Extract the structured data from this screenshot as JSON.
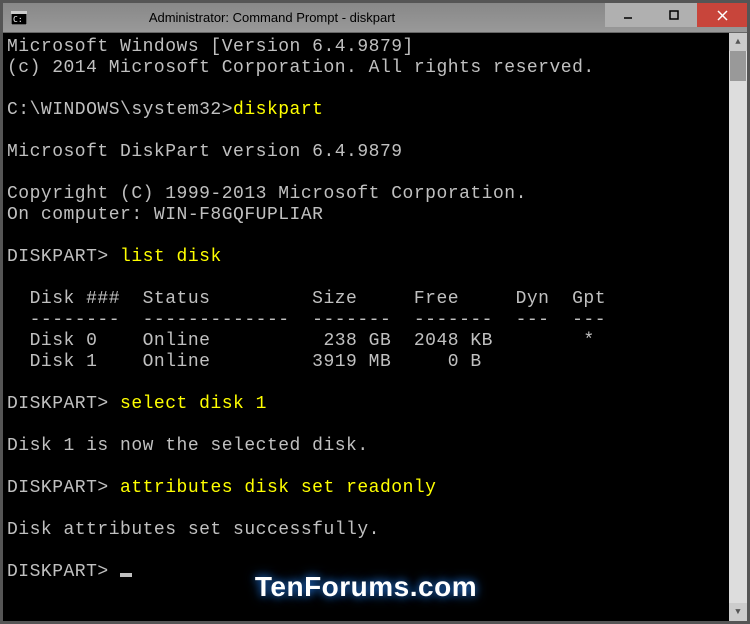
{
  "titlebar": {
    "title": "Administrator: Command Prompt - diskpart"
  },
  "terminal": {
    "line1": "Microsoft Windows [Version 6.4.9879]",
    "line2": "(c) 2014 Microsoft Corporation. All rights reserved.",
    "prompt1_path": "C:\\WINDOWS\\system32>",
    "prompt1_cmd": "diskpart",
    "diskpart_version": "Microsoft DiskPart version 6.4.9879",
    "copyright": "Copyright (C) 1999-2013 Microsoft Corporation.",
    "computer": "On computer: WIN-F8GQFUPLIAR",
    "dp_prompt": "DISKPART> ",
    "cmd_listdisk": "list disk",
    "table_header": "  Disk ###  Status         Size     Free     Dyn  Gpt",
    "table_divider": "  --------  -------------  -------  -------  ---  ---",
    "table_row0": "  Disk 0    Online          238 GB  2048 KB        *",
    "table_row1": "  Disk 1    Online         3919 MB     0 B",
    "cmd_selectdisk": "select disk 1",
    "select_result": "Disk 1 is now the selected disk.",
    "cmd_attributes": "attributes disk set readonly",
    "attr_result": "Disk attributes set successfully."
  },
  "watermark": "TenForums.com"
}
